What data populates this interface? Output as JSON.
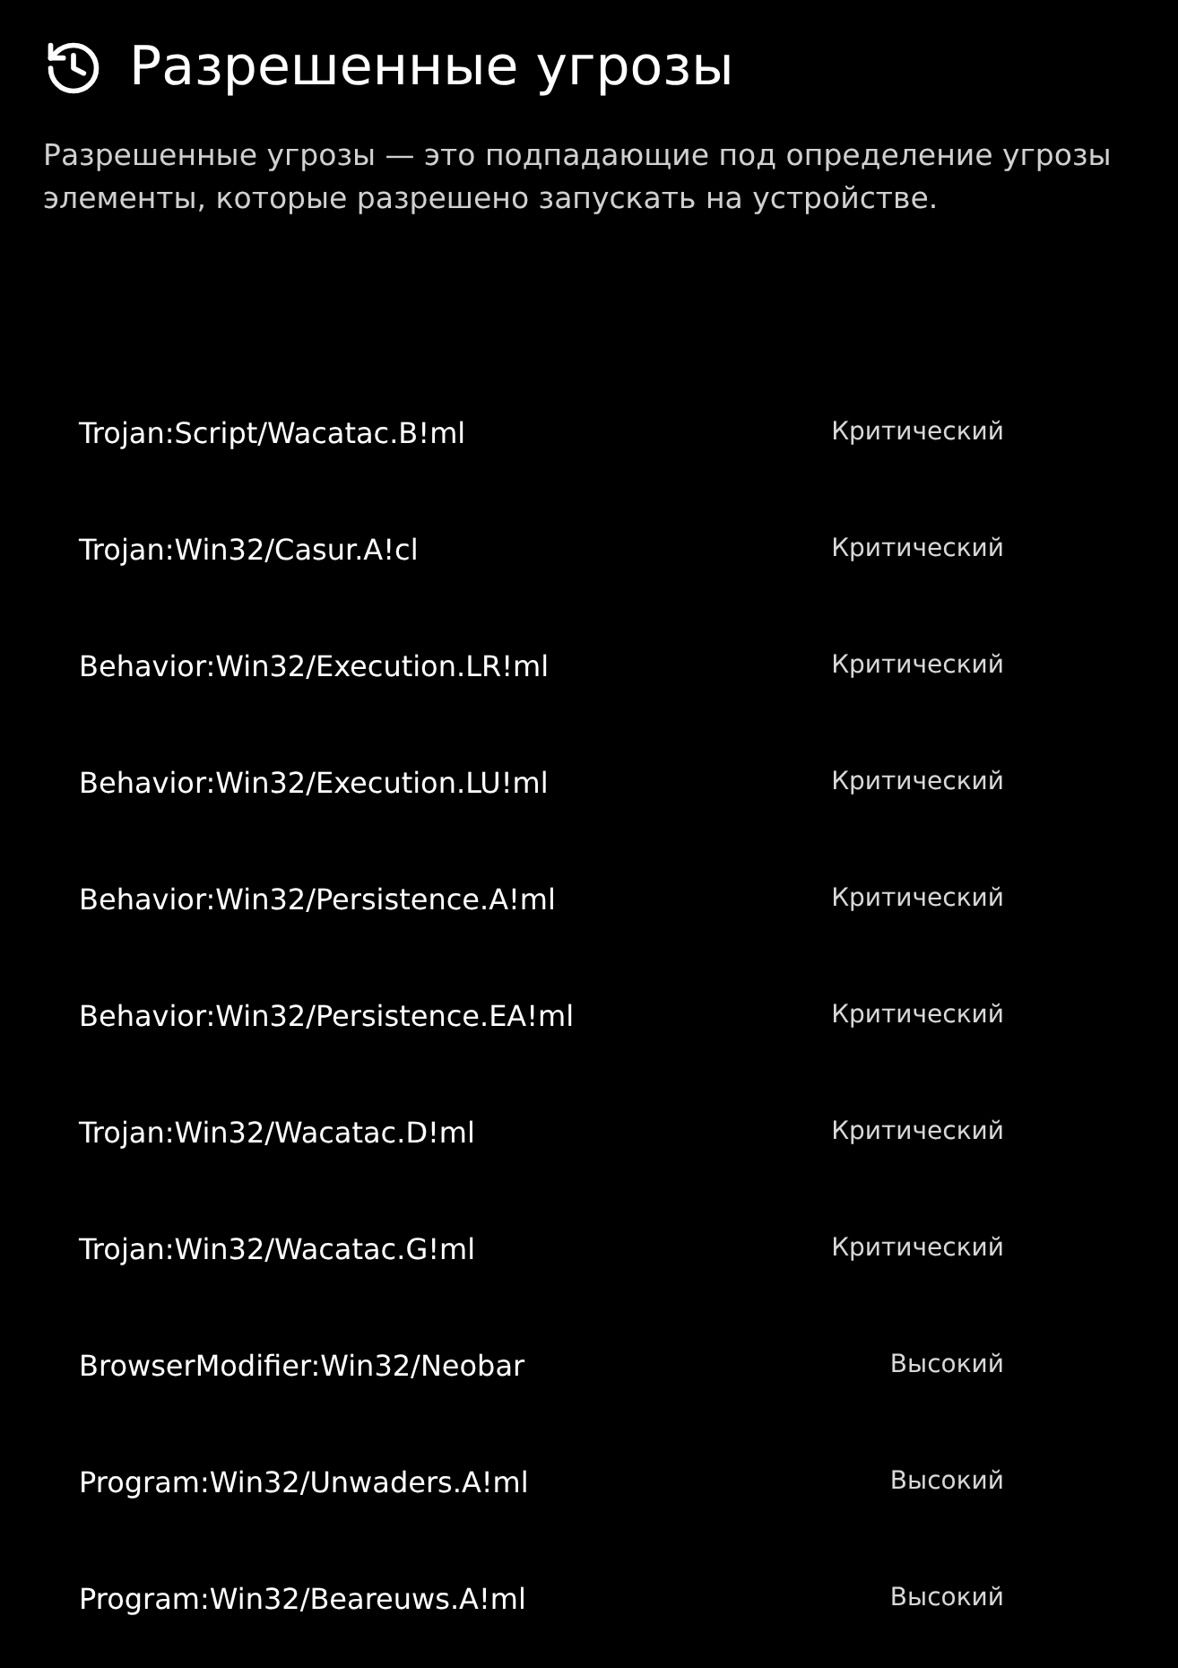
{
  "header": {
    "title": "Разрешенные угрозы",
    "description": "Разрешенные угрозы — это подпадающие под определение угрозы элементы, которые разрешено запускать на устройстве."
  },
  "threats": [
    {
      "name": "Trojan:Script/Wacatac.B!ml",
      "severity": "Критический"
    },
    {
      "name": "Trojan:Win32/Casur.A!cl",
      "severity": "Критический"
    },
    {
      "name": "Behavior:Win32/Execution.LR!ml",
      "severity": "Критический"
    },
    {
      "name": "Behavior:Win32/Execution.LU!ml",
      "severity": "Критический"
    },
    {
      "name": "Behavior:Win32/Persistence.A!ml",
      "severity": "Критический"
    },
    {
      "name": "Behavior:Win32/Persistence.EA!ml",
      "severity": "Критический"
    },
    {
      "name": "Trojan:Win32/Wacatac.D!ml",
      "severity": "Критический"
    },
    {
      "name": "Trojan:Win32/Wacatac.G!ml",
      "severity": "Критический"
    },
    {
      "name": "BrowserModifier:Win32/Neobar",
      "severity": "Высокий"
    },
    {
      "name": "Program:Win32/Unwaders.A!ml",
      "severity": "Высокий"
    },
    {
      "name": "Program:Win32/Beareuws.A!ml",
      "severity": "Высокий"
    }
  ]
}
